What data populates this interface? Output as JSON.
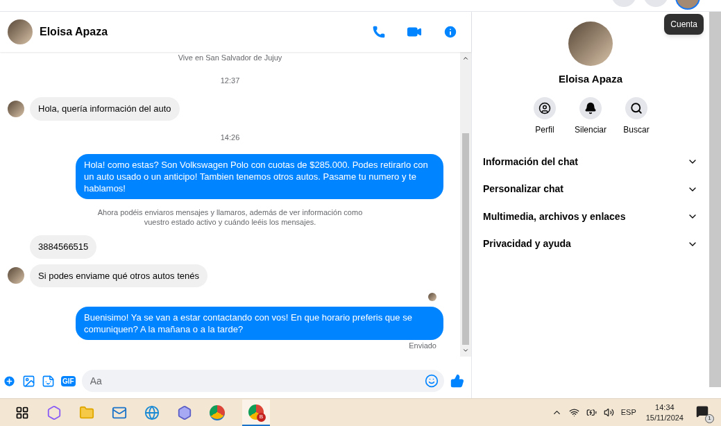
{
  "tooltip": "Cuenta",
  "chat": {
    "name": "Eloisa Apaza",
    "messages": [
      {
        "kind": "intro",
        "text": "Vive en San Salvador de Jujuy"
      },
      {
        "kind": "time",
        "text": "12:37"
      },
      {
        "kind": "in",
        "avatar": true,
        "text": "Hola, quería información del auto"
      },
      {
        "kind": "time",
        "text": "14:26"
      },
      {
        "kind": "out",
        "text": "Hola! como estas? Son Volkswagen Polo con cuotas de $285.000. Podes retirarlo con un auto usado o un anticipo! Tambien tenemos otros autos. Pasame tu numero y te hablamos!"
      },
      {
        "kind": "notice",
        "text": "Ahora podéis enviaros mensajes y llamaros, además de ver información como vuestro estado activo y cuándo leéis los mensajes."
      },
      {
        "kind": "in",
        "avatar": false,
        "text": "3884566515"
      },
      {
        "kind": "in",
        "avatar": true,
        "text": "Si podes enviame qué otros autos tenés"
      },
      {
        "kind": "seen"
      },
      {
        "kind": "out",
        "text": "Buenisimo! Ya se van a estar contactando con vos! En que horario preferis que se comuniquen? A la mañana o a la tarde?"
      },
      {
        "kind": "status",
        "text": "Enviado"
      }
    ],
    "composer": {
      "gif": "GIF",
      "placeholder": "Aa"
    }
  },
  "panel": {
    "name": "Eloisa Apaza",
    "actions": [
      {
        "kind": "profile",
        "label": "Perfil"
      },
      {
        "kind": "mute",
        "label": "Silenciar"
      },
      {
        "kind": "search",
        "label": "Buscar"
      }
    ],
    "sections": [
      {
        "label": "Información del chat",
        "expanded": false
      },
      {
        "label": "Personalizar chat",
        "expanded": false
      },
      {
        "label": "Multimedia, archivos y enlaces",
        "expanded": false
      },
      {
        "label": "Privacidad y ayuda",
        "expanded": false
      }
    ]
  },
  "taskbar": {
    "browser_badge": "B",
    "language": "ESP",
    "time": "14:34",
    "date": "15/11/2024",
    "notifications": "1"
  }
}
